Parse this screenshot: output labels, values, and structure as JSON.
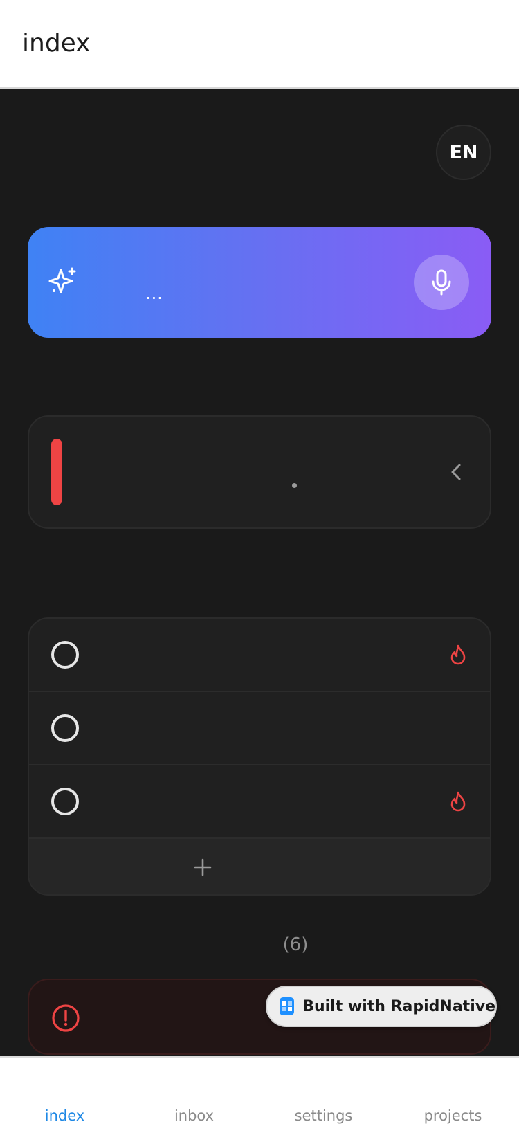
{
  "header": {
    "title": "index"
  },
  "language": {
    "label": "EN"
  },
  "ai_input": {
    "placeholder": "...",
    "icon": "sparkle-icon",
    "mic_icon": "microphone-icon"
  },
  "focus": {
    "accent_color": "#ef4444",
    "indicator": "."
  },
  "tasks": {
    "items": [
      {
        "priority_icon": "flame-icon"
      },
      {
        "priority_icon": ""
      },
      {
        "priority_icon": "flame-icon"
      }
    ],
    "add_label": "+"
  },
  "overdue": {
    "count_label": "(6)"
  },
  "badge": {
    "label": "Built with RapidNative"
  },
  "tabs": [
    {
      "label": "index",
      "active": true
    },
    {
      "label": "inbox",
      "active": false
    },
    {
      "label": "settings",
      "active": false
    },
    {
      "label": "projects",
      "active": false
    }
  ],
  "colors": {
    "accent": "#1e88e5",
    "danger": "#ef4444",
    "gradient_start": "#3f82f4",
    "gradient_end": "#8a5cf5"
  }
}
